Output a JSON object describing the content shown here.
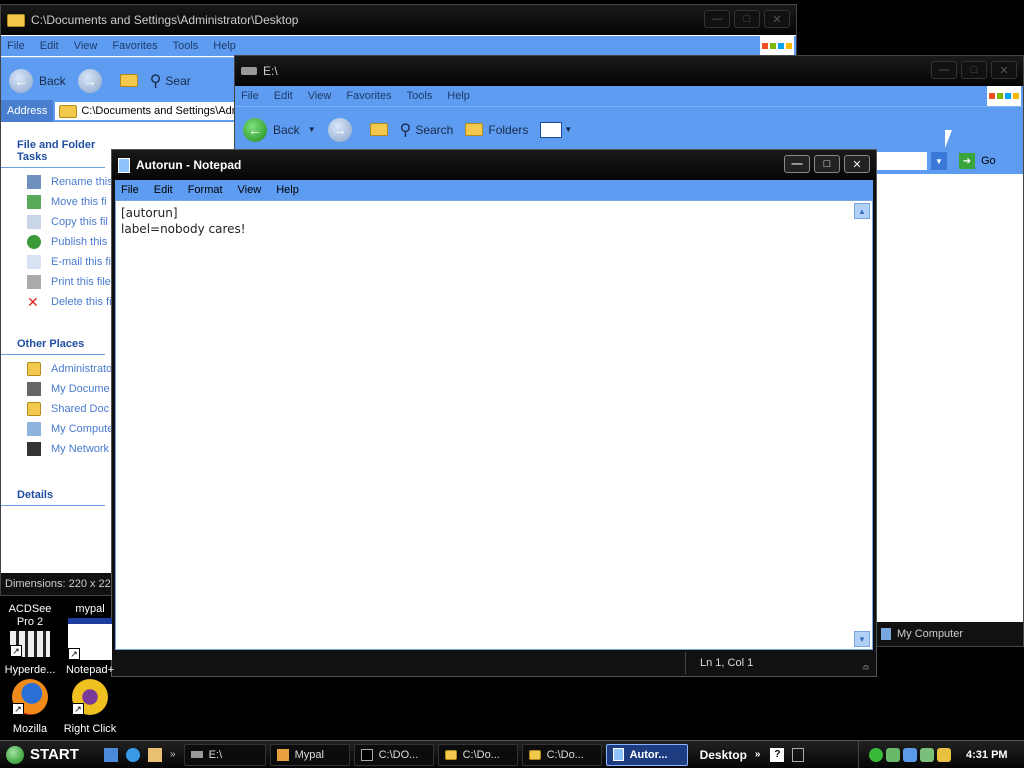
{
  "window_desktop": {
    "title": "C:\\Documents and Settings\\Administrator\\Desktop",
    "menu": [
      "File",
      "Edit",
      "View",
      "Favorites",
      "Tools",
      "Help"
    ],
    "toolbar": {
      "back_label": "Back",
      "search_label": "Sear"
    },
    "address_label": "Address",
    "address_value": "C:\\Documents and Settings\\Adm",
    "file_tasks_heading": "File and Folder Tasks",
    "file_tasks": [
      {
        "label": "Rename this",
        "icon": "rename-icon"
      },
      {
        "label": "Move this fi",
        "icon": "move-icon"
      },
      {
        "label": "Copy this fil",
        "icon": "copy-icon"
      },
      {
        "label": "Publish this",
        "icon": "globe-icon"
      },
      {
        "label": "E-mail this fi",
        "icon": "email-icon"
      },
      {
        "label": "Print this file",
        "icon": "printer-icon"
      },
      {
        "label": "Delete this fi",
        "icon": "delete-icon"
      }
    ],
    "other_places_heading": "Other Places",
    "other_places": [
      {
        "label": "Administrato",
        "icon": "folder-icon"
      },
      {
        "label": "My Docume",
        "icon": "documents-icon"
      },
      {
        "label": "Shared Doc",
        "icon": "folder-icon"
      },
      {
        "label": "My Compute",
        "icon": "computer-icon"
      },
      {
        "label": "My Network",
        "icon": "network-icon"
      }
    ],
    "details_heading": "Details",
    "status": "Dimensions: 220 x 22"
  },
  "window_e": {
    "title": "E:\\",
    "menu": [
      "File",
      "Edit",
      "View",
      "Favorites",
      "Tools",
      "Help"
    ],
    "toolbar": {
      "back_label": "Back",
      "search_label": "Search",
      "folders_label": "Folders"
    },
    "go_label": "Go",
    "status_location": "My Computer"
  },
  "notepad": {
    "title": "Autorun - Notepad",
    "menu": [
      "File",
      "Edit",
      "Format",
      "View",
      "Help"
    ],
    "content_line1": "[autorun]",
    "content_line2": "label=nobody cares!",
    "status": "Ln 1, Col 1"
  },
  "desktop_icons": [
    {
      "label": "ACDSee Pro 2",
      "icon": "acdsee-icon"
    },
    {
      "label": "mypal",
      "icon": "mypal-icon"
    },
    {
      "label": "Hyperde...",
      "icon": "hyperdesk-icon"
    },
    {
      "label": "Notepad+",
      "icon": "notepadplus-icon"
    },
    {
      "label": "Mozilla",
      "icon": "firefox-icon"
    },
    {
      "label": "Right Click",
      "icon": "rightclick-icon"
    }
  ],
  "taskbar": {
    "start_label": "START",
    "tasks": [
      {
        "label": "E:\\",
        "active": false
      },
      {
        "label": "Mypal",
        "active": false
      },
      {
        "label": "C:\\DO...",
        "active": false
      },
      {
        "label": "C:\\Do...",
        "active": false
      },
      {
        "label": "C:\\Do...",
        "active": false
      },
      {
        "label": "Autor...",
        "active": true
      }
    ],
    "desktop_label": "Desktop",
    "clock": "4:31 PM"
  },
  "colors": {
    "xp_blue": "#5d9cf0",
    "taskpane_link": "#4a7bd0",
    "active_task": "#1e3c80"
  }
}
